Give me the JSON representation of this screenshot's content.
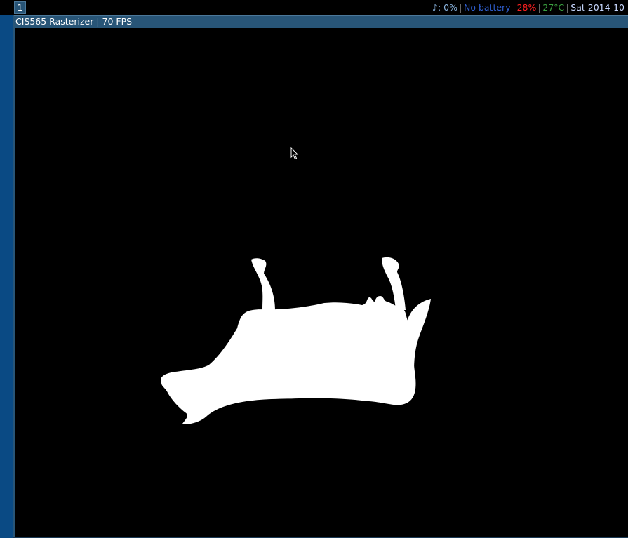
{
  "topbar": {
    "workspace_number": "1",
    "status": {
      "volume": "♪: 0%",
      "battery": "No battery",
      "cpu": "28%",
      "temperature": "27°C",
      "datetime": "Sat 2014-10"
    }
  },
  "window": {
    "title": "CIS565 Rasterizer | 70 FPS"
  },
  "colors": {
    "bar_bg": "#000000",
    "focused_title": "#285577",
    "volume": "#8ab4e0",
    "battery": "#2f5fd0",
    "cpu": "#ff2020",
    "temperature": "#3aa040",
    "datetime": "#c8d8ff",
    "model_fill": "#ffffff"
  },
  "icons": {
    "cursor": "mouse-pointer-icon"
  }
}
